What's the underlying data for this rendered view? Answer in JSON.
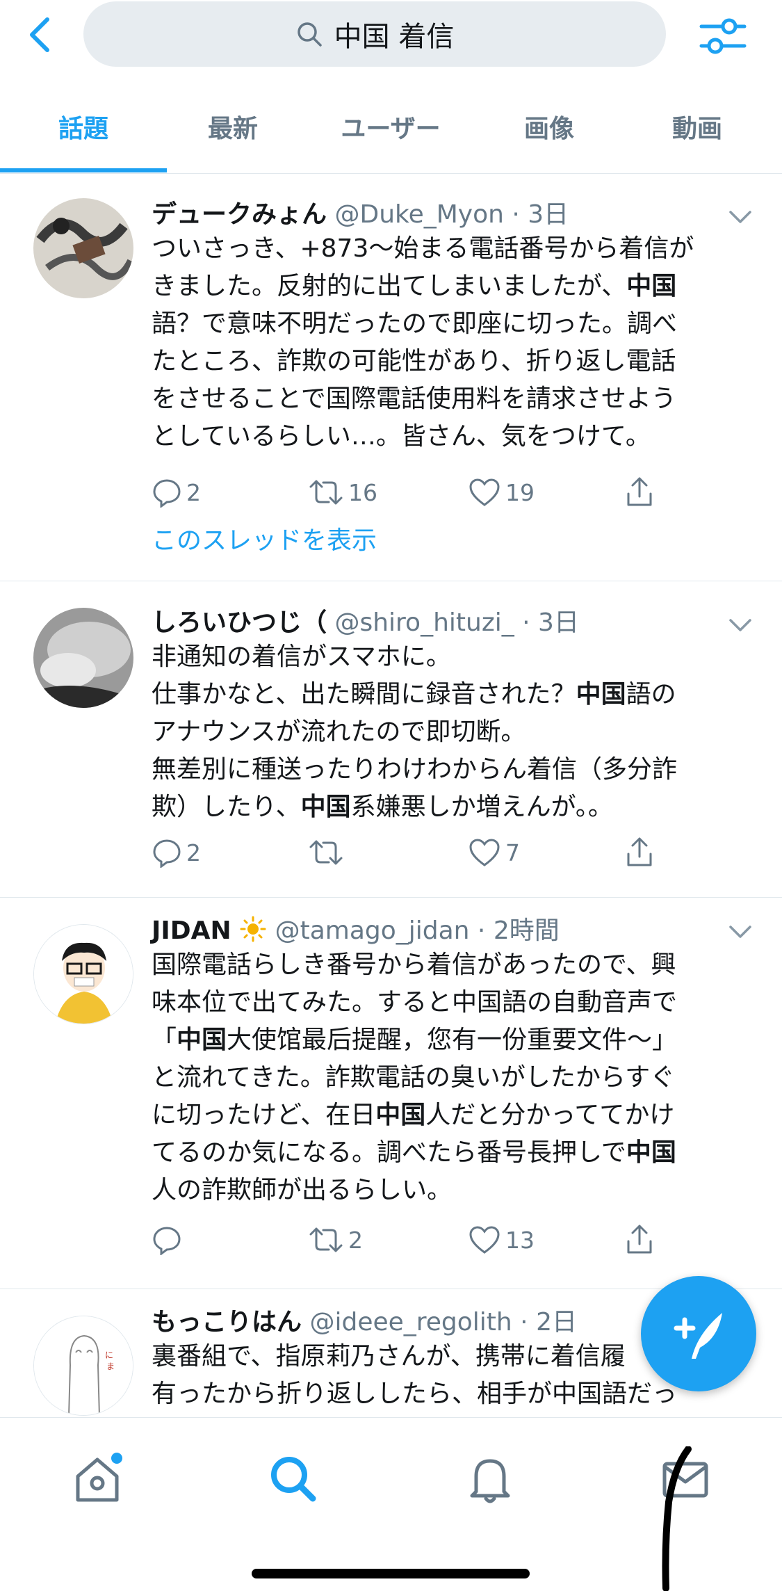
{
  "search": {
    "query": "中国 着信"
  },
  "tabs": [
    {
      "label": "話題",
      "active": true
    },
    {
      "label": "最新"
    },
    {
      "label": "ユーザー"
    },
    {
      "label": "画像"
    },
    {
      "label": "動画"
    }
  ],
  "colors": {
    "accent": "#1da1f2",
    "muted": "#657786",
    "text": "#14171a"
  },
  "tweets": [
    {
      "name": "デュークみょん",
      "meta": "@Duke_Myon · 3日",
      "lines": [
        "ついさっき、+873〜始まる電話番号から着信が",
        "きました。反射的に出てしまいましたが、",
        "語？で意味不明だったので即座に切った。調べ",
        "たところ、詐欺の可能性があり、折り返し電話",
        "をさせることで国際電話使用料を請求させよう",
        "としているらしい…。皆さん、気をつけて。"
      ],
      "bold_word": "中国",
      "replies": "2",
      "retweets": "16",
      "likes": "19",
      "thread": "このスレッドを表示"
    },
    {
      "name": "しろいひつじ（",
      "meta": "@shiro_hituzi_ · 3日",
      "l1": "非通知の着信がスマホに。",
      "l2a": "仕事かなと、出た瞬間に録音された？",
      "l2b": "語の",
      "l3": "アナウンスが流れたので即切断。",
      "l4": "無差別に種送ったりわけわからん着信（多分詐",
      "l5a": "欺）したり、",
      "l5b": "系嫌悪しか増えんが。。",
      "bold_word": "中国",
      "replies": "2",
      "retweets": "",
      "likes": "7"
    },
    {
      "name": "JIDAN",
      "meta": "@tamago_jidan · 2時間",
      "l1": "国際電話らしき番号から着信があったので、興",
      "l2": "味本位で出てみた。すると中国語の自動音声で",
      "l3a": "「",
      "l3b": "大使馆最后提醒，您有一份重要文件〜」",
      "l4": "と流れてきた。詐欺電話の臭いがしたからすぐ",
      "l5a": "に切ったけど、在日",
      "l5b": "人だと分かっててかけ",
      "l6a": "てるのか気になる。調べたら番号長押しで",
      "l7": "人の詐欺師が出るらしい。",
      "bold_word": "中国",
      "replies": "",
      "retweets": "2",
      "likes": "13"
    },
    {
      "name": "もっこりはん",
      "meta": "@ideee_regolith · 2日",
      "l1": "裏番組で、指原莉乃さんが、携帯に着信履",
      "l2": "有ったから折り返ししたら、相手が中国語だっ"
    }
  ]
}
